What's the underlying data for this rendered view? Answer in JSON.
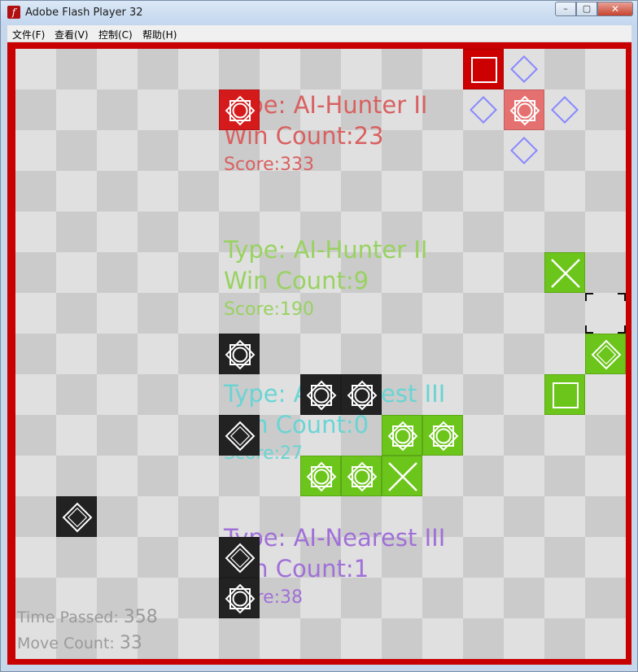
{
  "window": {
    "title": "Adobe Flash Player 32",
    "app_icon_glyph": "f",
    "controls": {
      "minimize": "–",
      "maximize": "▢",
      "close": "✕"
    }
  },
  "menu": {
    "items": [
      "文件(F)",
      "查看(V)",
      "控制(C)",
      "帮助(H)"
    ]
  },
  "colors": {
    "frame": "#c90000",
    "light_square": "#e0e0e0",
    "dark_square": "#cbcbcb",
    "red_player": "#d41a1a",
    "red_text": "#d96060",
    "green_player": "#6cc51a",
    "green_text": "#98d260",
    "cyan_text": "#6ad4d4",
    "purple_text": "#a070d8",
    "black_player": "#222222",
    "hint_diamond": "#8888ff"
  },
  "players": [
    {
      "type": "Type: AI-Hunter II",
      "win_count": "Win Count:23",
      "score": "Score:333",
      "color": "#d96060"
    },
    {
      "type": "Type: AI-Hunter II",
      "win_count": "Win Count:9",
      "score": "Score:190",
      "color": "#98d260"
    },
    {
      "type": "Type: AI-Nearest III",
      "win_count": "Win Count:0",
      "score": "Score:27",
      "color": "#6ad4d4"
    },
    {
      "type": "Type: AI-Nearest III",
      "win_count": "Win Count:1",
      "score": "Score:38",
      "color": "#a070d8"
    }
  ],
  "stats": {
    "time_label": "Time Passed:",
    "time_value": "358",
    "move_label": "Move Count:",
    "move_value": "33"
  },
  "board": {
    "columns": 15,
    "rows": 15,
    "pieces": [
      {
        "col": 5,
        "row": 1,
        "color": "#d41a1a",
        "icon": "star-circle-icon"
      },
      {
        "col": 11,
        "row": 0,
        "color": "#cc0000",
        "icon": "square-icon"
      },
      {
        "col": 12,
        "row": 1,
        "color": "#e57070",
        "icon": "star-circle-icon"
      },
      {
        "col": 13,
        "row": 5,
        "color": "#6cc51a",
        "icon": "x-icon"
      },
      {
        "col": 14,
        "row": 7,
        "color": "#6cc51a",
        "icon": "diamond-icon"
      },
      {
        "col": 13,
        "row": 8,
        "color": "#6cc51a",
        "icon": "square-icon"
      },
      {
        "col": 9,
        "row": 9,
        "color": "#6cc51a",
        "icon": "star-circle-icon"
      },
      {
        "col": 10,
        "row": 9,
        "color": "#6cc51a",
        "icon": "star-circle-icon"
      },
      {
        "col": 7,
        "row": 10,
        "color": "#6cc51a",
        "icon": "star-circle-icon"
      },
      {
        "col": 8,
        "row": 10,
        "color": "#6cc51a",
        "icon": "star-circle-icon"
      },
      {
        "col": 9,
        "row": 10,
        "color": "#6cc51a",
        "icon": "x-icon"
      },
      {
        "col": 5,
        "row": 7,
        "color": "#222222",
        "icon": "star-circle-icon"
      },
      {
        "col": 7,
        "row": 8,
        "color": "#222222",
        "icon": "star-circle-icon"
      },
      {
        "col": 8,
        "row": 8,
        "color": "#222222",
        "icon": "star-circle-icon"
      },
      {
        "col": 5,
        "row": 9,
        "color": "#222222",
        "icon": "diamond-icon"
      },
      {
        "col": 1,
        "row": 11,
        "color": "#222222",
        "icon": "diamond-icon"
      },
      {
        "col": 5,
        "row": 12,
        "color": "#222222",
        "icon": "diamond-icon"
      },
      {
        "col": 5,
        "row": 13,
        "color": "#222222",
        "icon": "star-circle-icon"
      }
    ],
    "hints": [
      {
        "col": 12,
        "row": 0
      },
      {
        "col": 11,
        "row": 1
      },
      {
        "col": 13,
        "row": 1
      },
      {
        "col": 12,
        "row": 2
      }
    ],
    "selector": {
      "col": 14,
      "row": 6
    }
  }
}
